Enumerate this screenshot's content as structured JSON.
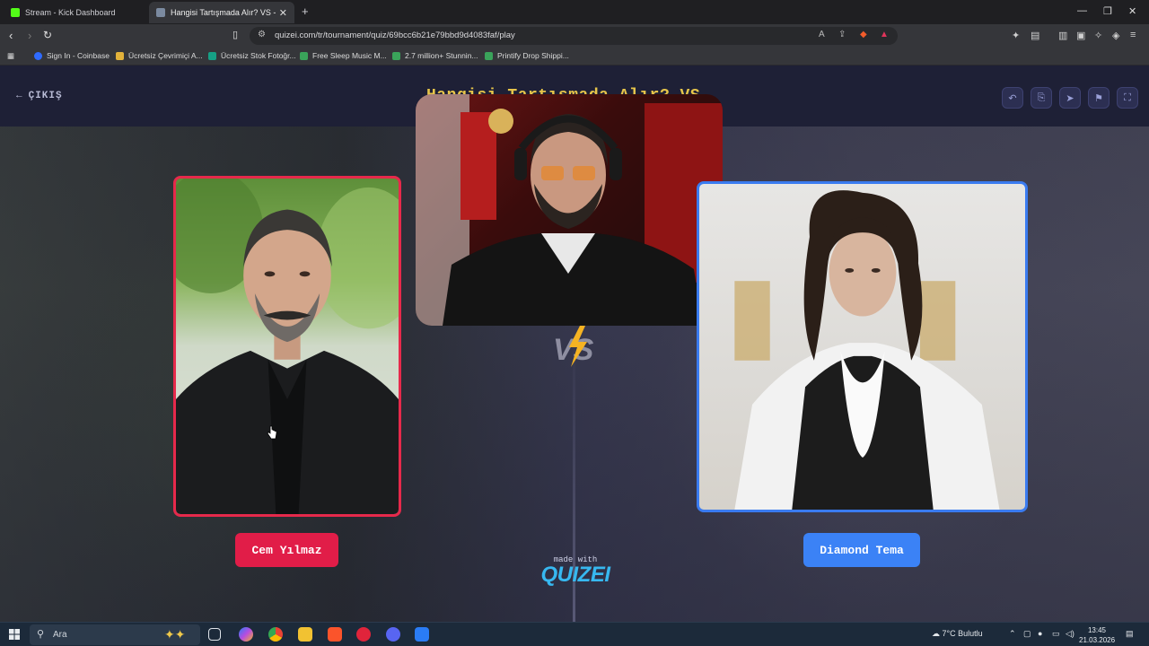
{
  "browser": {
    "tabs": [
      {
        "title": "Stream - Kick Dashboard",
        "favicon_color": "#53fc18",
        "active": false
      },
      {
        "title": "Hangisi Tartışmada Alır? VS - Tie",
        "favicon_color": "#7b8aa0",
        "active": true
      }
    ],
    "url": "quizei.com/tr/tournament/quiz/69bcc6b21e79bbd9d4083faf/play",
    "bookmarks": [
      {
        "label": "Sign In - Coinbase",
        "color": "#2f6bff"
      },
      {
        "label": "Ücretsiz Çevrimiçi A...",
        "color": "#e2b23a"
      },
      {
        "label": "Ücretsiz Stok Fotoğr...",
        "color": "#16a085"
      },
      {
        "label": "Free Sleep Music M...",
        "color": "#3aa35a"
      },
      {
        "label": "2.7 million+ Stunnin...",
        "color": "#3aa35a"
      },
      {
        "label": "Printify Drop Shippi...",
        "color": "#3aa35a"
      }
    ]
  },
  "page": {
    "back_label": "ÇIKIŞ",
    "title": "Hangisi Tartışmada Alır? VS",
    "vs_label": "VS",
    "left": {
      "name": "Cem Yılmaz",
      "color": "#e11d48"
    },
    "right": {
      "name": "Diamond Tema",
      "color": "#3b82f6"
    },
    "made_with": "made with",
    "brand": "QUIZEI"
  },
  "taskbar": {
    "search_placeholder": "Ara",
    "weather": "7°C  Bulutlu",
    "time": "13:45",
    "date": "21.03.2026"
  }
}
